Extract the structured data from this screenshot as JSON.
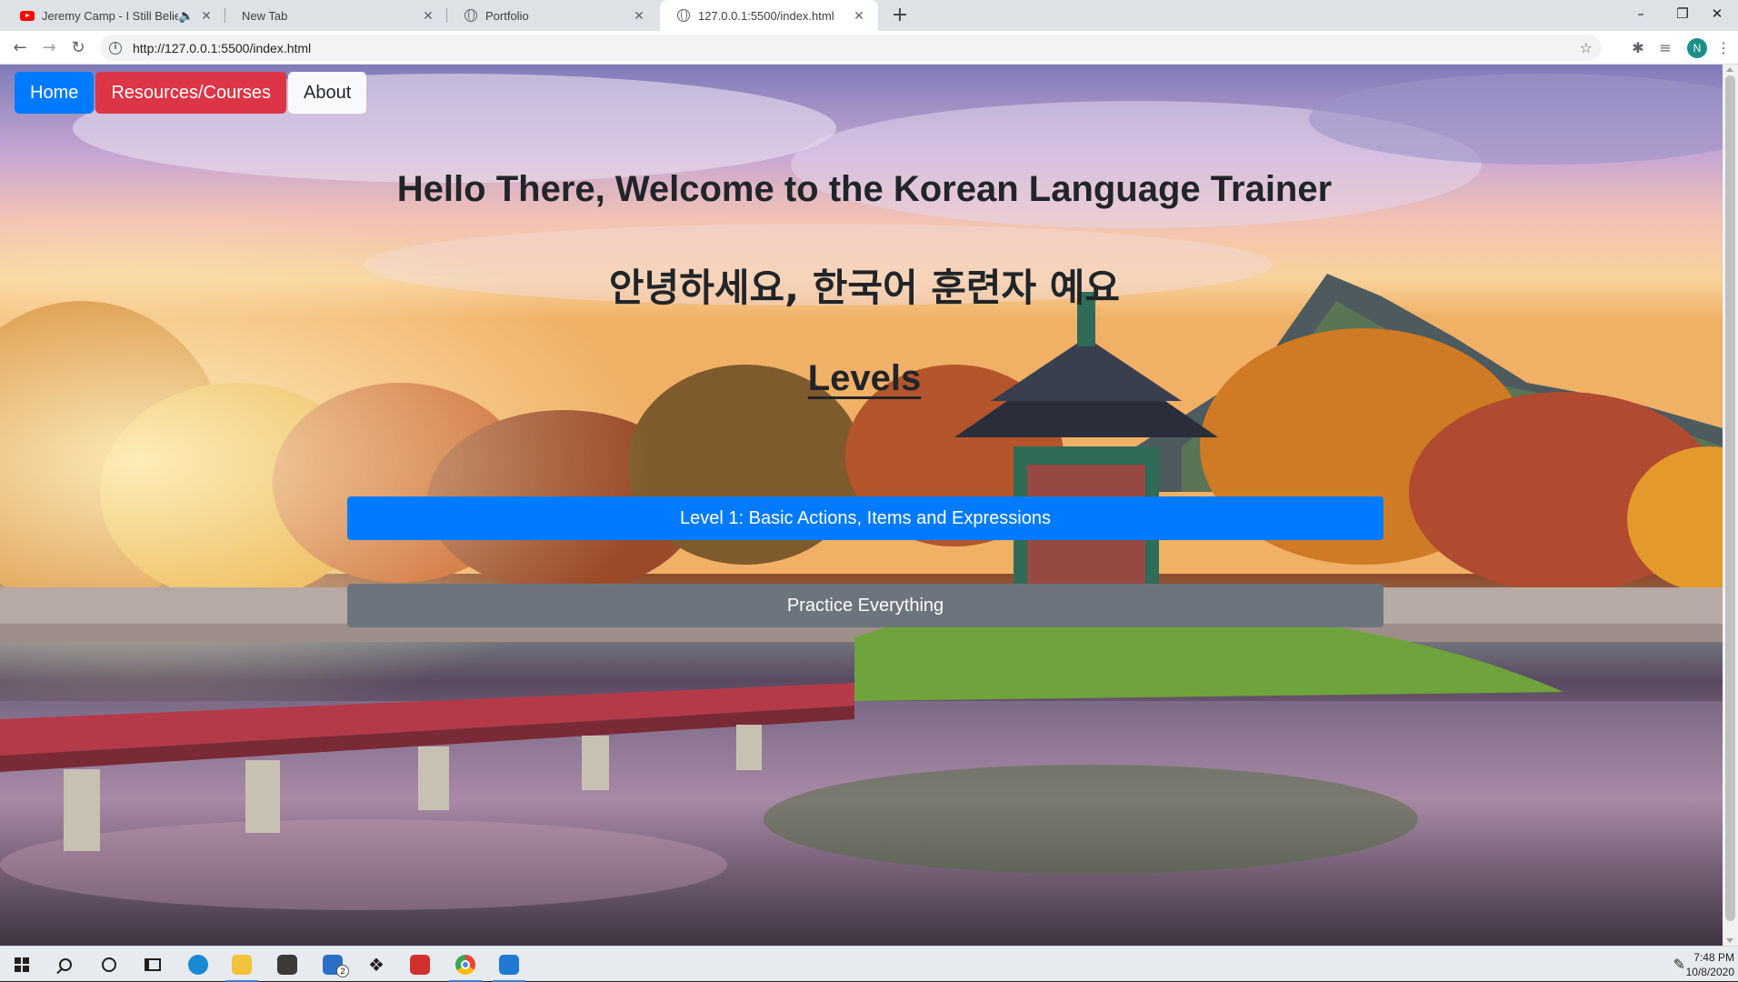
{
  "browser": {
    "tabs": [
      {
        "title": "Jeremy Camp - I Still Believe",
        "favicon": "youtube-icon",
        "audio": true
      },
      {
        "title": "New Tab",
        "favicon": "none"
      },
      {
        "title": "Portfolio",
        "favicon": "globe-icon"
      },
      {
        "title": "127.0.0.1:5500/index.html",
        "favicon": "globe-icon",
        "active": true
      }
    ],
    "url": "http://127.0.0.1:5500/index.html",
    "profile_initial": "N",
    "window_controls": {
      "minimize": "–",
      "restore": "❐",
      "close": "✕"
    }
  },
  "site": {
    "nav": {
      "home": "Home",
      "resources": "Resources/Courses",
      "about": "About"
    },
    "heading": "Hello There, Welcome to the Korean Language Trainer",
    "korean_heading": "안녕하세요, 한국어 훈련자 예요",
    "levels_heading": "Levels",
    "level_buttons": [
      "Level 1: Basic Actions, Items and Expressions",
      "Practice Everything"
    ]
  },
  "taskbar": {
    "time": "7:48 PM",
    "date": "10/8/2020",
    "mail_badge": "2"
  },
  "colors": {
    "primary": "#007bff",
    "danger": "#dc3545",
    "secondary": "#6c757d",
    "light": "#f8f9fa"
  }
}
